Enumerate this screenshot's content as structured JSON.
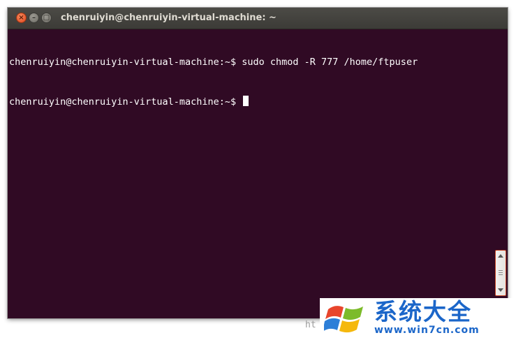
{
  "window": {
    "title": "chenruiyin@chenruiyin-virtual-machine: ~",
    "buttons": {
      "close_icon": "close-icon",
      "minimize_icon": "minimize-icon",
      "maximize_icon": "maximize-icon"
    }
  },
  "terminal": {
    "background": "#300a24",
    "foreground": "#ffffff",
    "lines": [
      "chenruiyin@chenruiyin-virtual-machine:~$ sudo chmod -R 777 /home/ftpuser",
      "chenruiyin@chenruiyin-virtual-machine:~$ "
    ]
  },
  "watermark": {
    "partial_text": "ht",
    "title": "系统大全",
    "url": "www.win7cn.com",
    "color": "#1b66c9"
  }
}
